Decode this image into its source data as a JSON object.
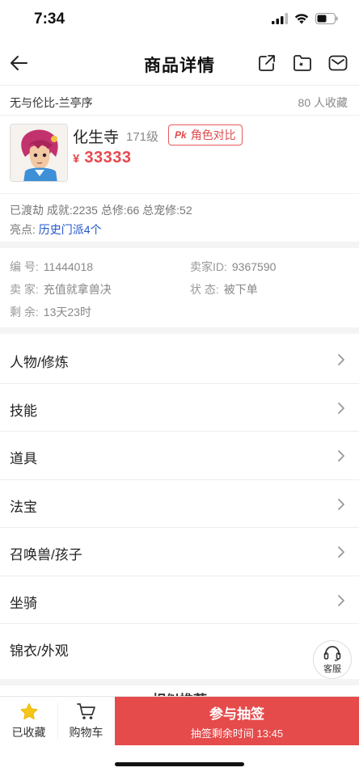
{
  "status_bar": {
    "time": "7:34"
  },
  "nav": {
    "title": "商品详情",
    "icons": [
      "back-arrow-icon",
      "share-icon",
      "favorite-folder-icon",
      "message-icon"
    ]
  },
  "listing": {
    "server": "无与伦比-兰亭序",
    "favorites_count": "80 人收藏"
  },
  "character": {
    "school": "化生寺",
    "level": "171级",
    "pk_label": "角色对比",
    "pk_mark": "Pk",
    "price_symbol": "¥",
    "price": "33333",
    "stats": "已渡劫 成就:2235 总修:66 总宠修:52",
    "highlight_label": "亮点:",
    "highlight_value": "历史门派4个"
  },
  "info": {
    "id_label": "编 号:",
    "id_value": "11444018",
    "seller_id_label": "卖家ID:",
    "seller_id_value": "9367590",
    "seller_label": "卖 家:",
    "seller_value": "充值就拿兽决",
    "status_label": "状 态:",
    "status_value": "被下单",
    "remaining_label": "剩 余:",
    "remaining_value": "13天23时"
  },
  "menu": [
    {
      "label": "人物/修炼",
      "chevron": true
    },
    {
      "label": "技能",
      "chevron": true
    },
    {
      "label": "道具",
      "chevron": true
    },
    {
      "label": "法宝",
      "chevron": true
    },
    {
      "label": "召唤兽/孩子",
      "chevron": true
    },
    {
      "label": "坐骑",
      "chevron": true
    },
    {
      "label": "锦衣/外观",
      "chevron": false
    }
  ],
  "customer_service": {
    "label": "客服"
  },
  "recommend": {
    "title": "相似推荐"
  },
  "bottom_bar": {
    "favorited_label": "已收藏",
    "cart_label": "购物车",
    "cta_main": "参与抽签",
    "cta_sub": "抽签剩余时间 13:45"
  },
  "colors": {
    "accent_red": "#e54b4b",
    "price_red": "#e5484d",
    "link_blue": "#2255cc",
    "star_yellow": "#f5c518"
  }
}
